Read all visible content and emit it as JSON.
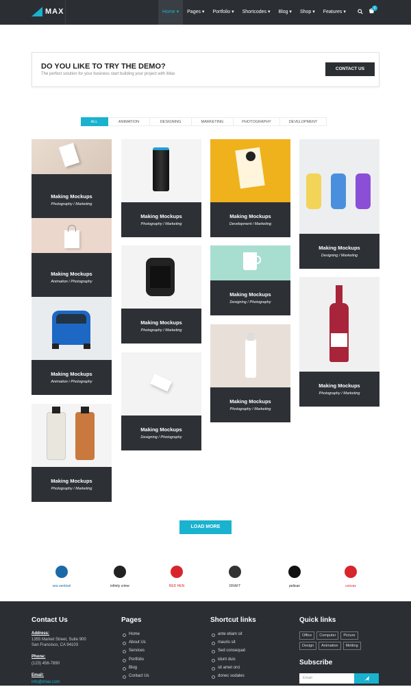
{
  "header": {
    "logo_text": "MAX",
    "nav": [
      "Home ▾",
      "Pages ▾",
      "Portfolio ▾",
      "Shortcodes ▾",
      "Blog ▾",
      "Shop ▾",
      "Features ▾"
    ],
    "active_nav": "Home ▾",
    "cart_count": "0"
  },
  "demo": {
    "title": "DO YOU LIKE TO TRY THE DEMO?",
    "subtitle": "The perfect solution for your business start building your project with iMax",
    "button": "CONTACT US"
  },
  "filters": [
    "ALL",
    "ANIMATION",
    "DESIGNING",
    "MARKETING",
    "PHOTOGRAPHY",
    "DEVELOPMENT"
  ],
  "portfolio": [
    {
      "title": "Making Mockups",
      "cats": "Photography / Marketing",
      "image": "paper"
    },
    {
      "title": "Making Mockups",
      "cats": "Animation / Photography",
      "image": "bag"
    },
    {
      "title": "Making Mockups",
      "cats": "Animation / Photography",
      "image": "car"
    },
    {
      "title": "Making Mockups",
      "cats": "Photography / Marketing",
      "image": "bottles"
    },
    {
      "title": "Making Mockups",
      "cats": "Photography / Marketing",
      "image": "can"
    },
    {
      "title": "Making Mockups",
      "cats": "Photography / Marketing",
      "image": "watch"
    },
    {
      "title": "Making Mockups",
      "cats": "Designing / Photography",
      "image": "card"
    },
    {
      "title": "Making Mockups",
      "cats": "Development / Marketing",
      "image": "sticker"
    },
    {
      "title": "Making Mockups",
      "cats": "Designing / Photography",
      "image": "mug"
    },
    {
      "title": "Making Mockups",
      "cats": "Photography / Marketing",
      "image": "tube"
    },
    {
      "title": "Making Mockups",
      "cats": "Designing / Marketing",
      "image": "glass"
    },
    {
      "title": "Making Mockups",
      "cats": "Photography / Marketing",
      "image": "wine"
    }
  ],
  "load_more": "LOAD MORE",
  "brands": [
    {
      "name": "sea sentinel",
      "icon": "seal-logo-icon",
      "color": "#1b6aa8"
    },
    {
      "name": "infinity crime",
      "icon": "infinity-logo-icon",
      "color": "#222222"
    },
    {
      "name": "RED HEN",
      "icon": "rooster-logo-icon",
      "color": "#d8252c"
    },
    {
      "name": "DRAFT",
      "icon": "draft-logo-icon",
      "color": "#333333"
    },
    {
      "name": "pelican",
      "icon": "pelican-logo-icon",
      "color": "#111111"
    },
    {
      "name": "convax",
      "icon": "convax-logo-icon",
      "color": "#d8252c"
    }
  ],
  "footer": {
    "contact_title": "Contact Us",
    "address_label": "Address:",
    "address": "1355 Market Street, Suite 900 San Francisco, CA 94103",
    "phone_label": "Phone:",
    "phone": "(123) 456-7890",
    "email_label": "Email:",
    "email": "info@imax.com",
    "pages_title": "Pages",
    "pages": [
      "Home",
      "About Us",
      "Services",
      "Portfolio",
      "Blog",
      "Contact Us"
    ],
    "shortcut_title": "Shortcut links",
    "shortcuts": [
      "ante etiam sit",
      "mauris sit",
      "Sed consequat",
      "idunt duis",
      "sit amet orci",
      "donec sodales"
    ],
    "quick_title": "Quick links",
    "quick": [
      "Office",
      "Computer",
      "Picture",
      "Design",
      "Animation",
      "Metting"
    ],
    "subscribe_title": "Subscribe",
    "email_placeholder": "Email"
  },
  "colors": {
    "accent": "#19b2cf",
    "dark": "#2b2f34"
  }
}
